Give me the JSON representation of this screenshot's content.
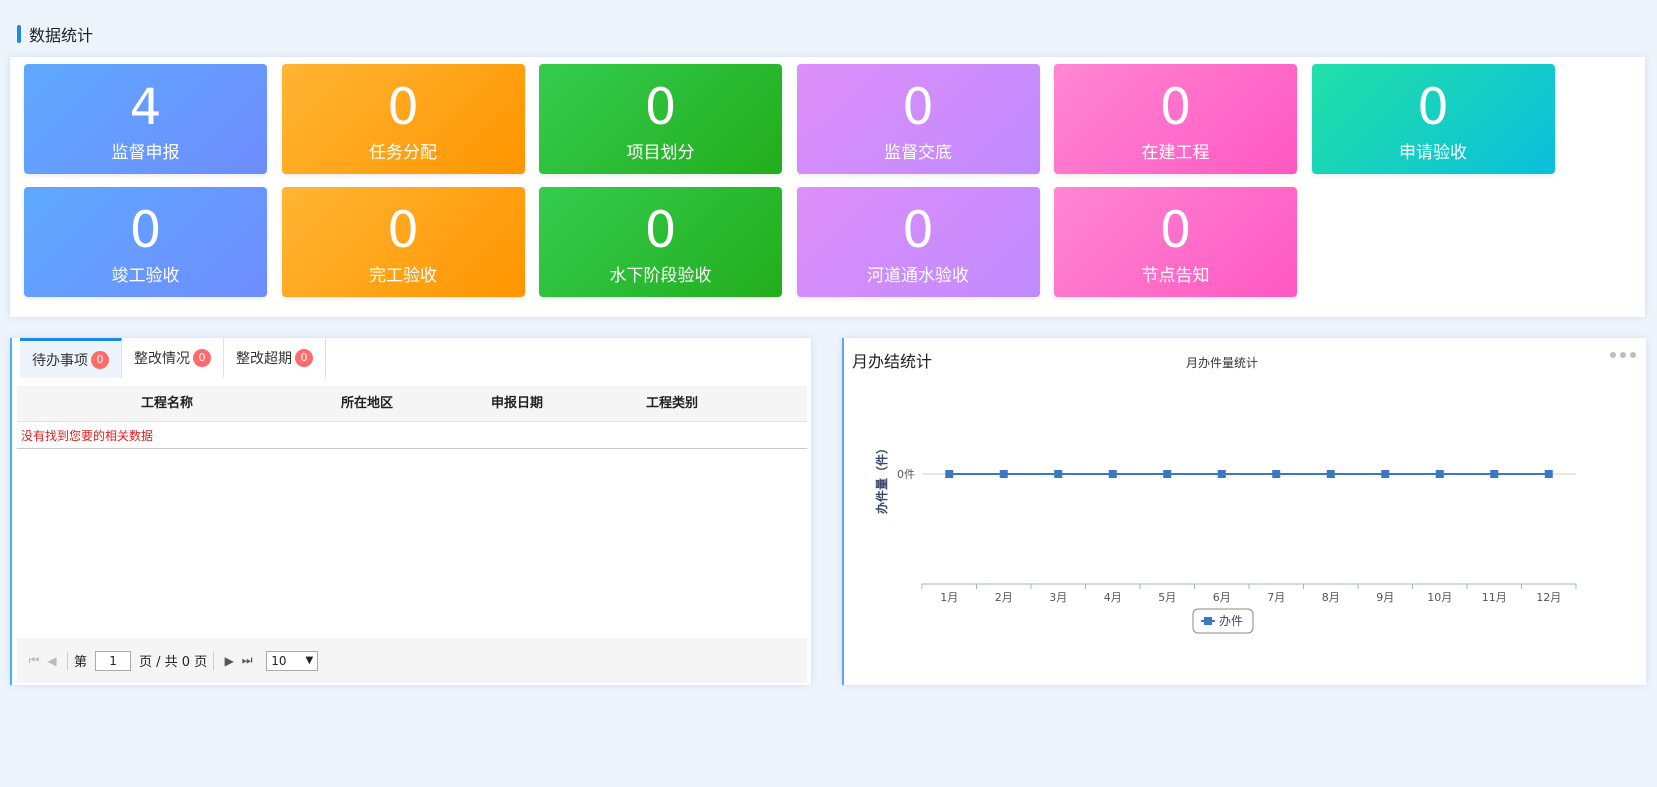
{
  "section": {
    "title": "数据统计"
  },
  "stats": [
    {
      "value": "4",
      "label": "监督申报",
      "color": "blue"
    },
    {
      "value": "0",
      "label": "任务分配",
      "color": "orange"
    },
    {
      "value": "0",
      "label": "项目划分",
      "color": "green"
    },
    {
      "value": "0",
      "label": "监督交底",
      "color": "purple"
    },
    {
      "value": "0",
      "label": "在建工程",
      "color": "pink"
    },
    {
      "value": "0",
      "label": "申请验收",
      "color": "teal"
    },
    {
      "value": "0",
      "label": "竣工验收",
      "color": "blue"
    },
    {
      "value": "0",
      "label": "完工验收",
      "color": "orange"
    },
    {
      "value": "0",
      "label": "水下阶段验收",
      "color": "green"
    },
    {
      "value": "0",
      "label": "河道通水验收",
      "color": "purple"
    },
    {
      "value": "0",
      "label": "节点告知",
      "color": "pink"
    }
  ],
  "todo": {
    "tabs": [
      {
        "label": "待办事项",
        "count": "0"
      },
      {
        "label": "整改情况",
        "count": "0"
      },
      {
        "label": "整改超期",
        "count": "0"
      }
    ],
    "columns": [
      "工程名称",
      "所在地区",
      "申报日期",
      "工程类别"
    ],
    "empty_text": "没有找到您要的相关数据",
    "pager": {
      "page_prefix": "第",
      "page_value": "1",
      "page_suffix": "页 / 共 0 页",
      "page_size": "10"
    }
  },
  "chart_panel": {
    "title": "月办结统计"
  },
  "chart_data": {
    "type": "line",
    "title": "月办件量统计",
    "ylabel": "办件量（件）",
    "y_tick_label": "0件",
    "categories": [
      "1月",
      "2月",
      "3月",
      "4月",
      "5月",
      "6月",
      "7月",
      "8月",
      "9月",
      "10月",
      "11月",
      "12月"
    ],
    "series": [
      {
        "name": "办件",
        "values": [
          0,
          0,
          0,
          0,
          0,
          0,
          0,
          0,
          0,
          0,
          0,
          0
        ],
        "color": "#3a78c2"
      }
    ],
    "legend_position": "bottom-center",
    "grid": false
  }
}
